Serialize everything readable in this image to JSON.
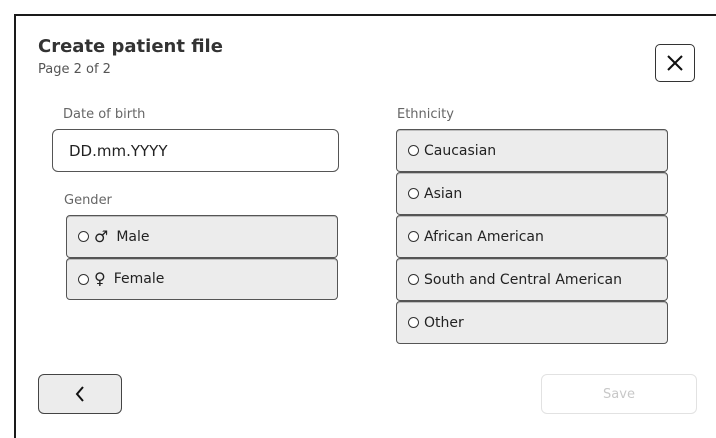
{
  "header": {
    "title": "Create patient file",
    "subtitle": "Page 2 of 2",
    "close_icon": "close-icon"
  },
  "date_of_birth": {
    "label": "Date of birth",
    "value": "DD.mm.YYYY"
  },
  "gender": {
    "label": "Gender",
    "options": [
      {
        "symbol": "♂",
        "label": "Male",
        "icon": "male-symbol-icon"
      },
      {
        "symbol": "♀",
        "label": "Female",
        "icon": "female-symbol-icon"
      }
    ]
  },
  "ethnicity": {
    "label": "Ethnicity",
    "options": [
      {
        "label": "Caucasian"
      },
      {
        "label": "Asian"
      },
      {
        "label": "African American"
      },
      {
        "label": "South and Central American"
      },
      {
        "label": "Other"
      }
    ]
  },
  "footer": {
    "back_icon": "chevron-left-icon",
    "save_label": "Save"
  }
}
